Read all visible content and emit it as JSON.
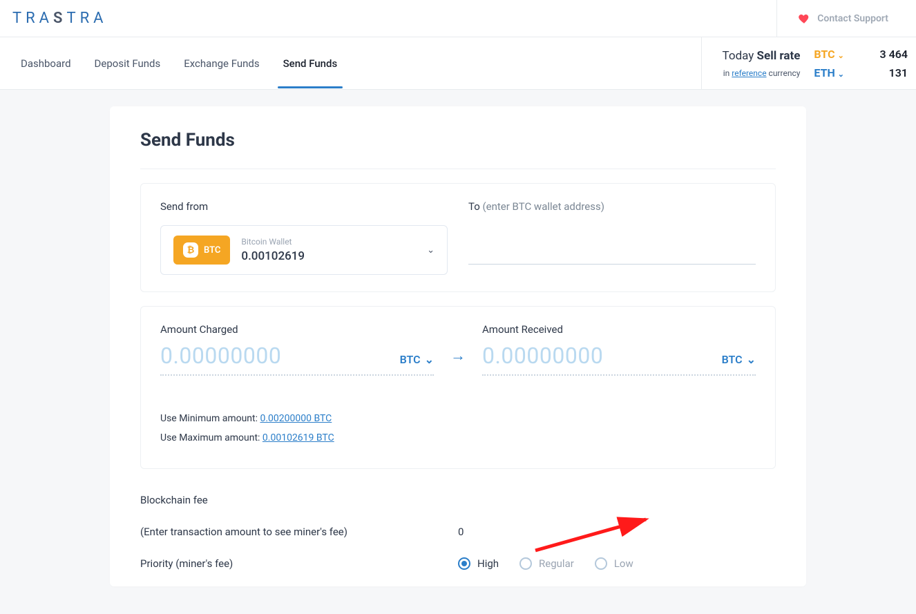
{
  "brand": "TRASTRA",
  "support_label": "Contact Support",
  "nav": {
    "dashboard": "Dashboard",
    "deposit": "Deposit Funds",
    "exchange": "Exchange Funds",
    "send": "Send Funds"
  },
  "rates": {
    "today": "Today ",
    "sell": "Sell rate",
    "sub_in": "in ",
    "sub_ref": "reference",
    "sub_cur": " currency",
    "btc_label": "BTC",
    "eth_label": "ETH",
    "btc_value": "3 464",
    "eth_value": "131"
  },
  "page_title": "Send Funds",
  "send_from": {
    "label": "Send from",
    "badge_text": "BTC",
    "wallet_name": "Bitcoin Wallet",
    "wallet_balance": "0.00102619"
  },
  "to": {
    "label_prefix": "To ",
    "label_hint": "(enter BTC wallet address)"
  },
  "amount_charged": {
    "label": "Amount Charged",
    "placeholder": "0.00000000",
    "currency": "BTC"
  },
  "amount_received": {
    "label": "Amount Received",
    "placeholder": "0.00000000",
    "currency": "BTC"
  },
  "limits": {
    "min_label": "Use Minimum amount:  ",
    "min_value": "0.00200000 BTC",
    "max_label": "Use Maximum amount:  ",
    "max_value": "0.00102619 BTC"
  },
  "fee": {
    "title": "Blockchain fee",
    "hint": "(Enter transaction amount to see miner's fee)",
    "value": "0",
    "priority_label": "Priority (miner's fee)",
    "options": {
      "high": "High",
      "regular": "Regular",
      "low": "Low"
    }
  }
}
